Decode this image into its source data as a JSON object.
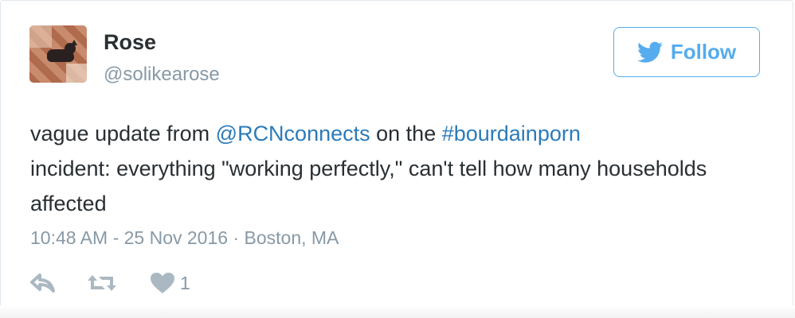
{
  "user": {
    "name": "Rose",
    "handle": "@solikearose",
    "avatar_icon": "avatar-photo"
  },
  "follow_button": {
    "label": "Follow",
    "icon": "twitter-bird-icon",
    "color": "#55acee"
  },
  "tweet": {
    "segments": [
      {
        "text": "vague update from ",
        "type": "text"
      },
      {
        "text": "@RCNconnects",
        "type": "mention"
      },
      {
        "text": " on the ",
        "type": "text"
      },
      {
        "text": "#bourdainporn",
        "type": "hashtag"
      },
      {
        "text": " incident: everything \"working perfectly,\" can't tell how many households affected",
        "type": "text"
      }
    ],
    "link_color": "#2b7bb9"
  },
  "meta": {
    "timestamp": "10:48 AM - 25 Nov 2016",
    "separator": " · ",
    "location": "Boston, MA"
  },
  "actions": {
    "reply_icon": "reply-icon",
    "retweet_icon": "retweet-icon",
    "like_icon": "heart-icon",
    "like_count": "1"
  }
}
